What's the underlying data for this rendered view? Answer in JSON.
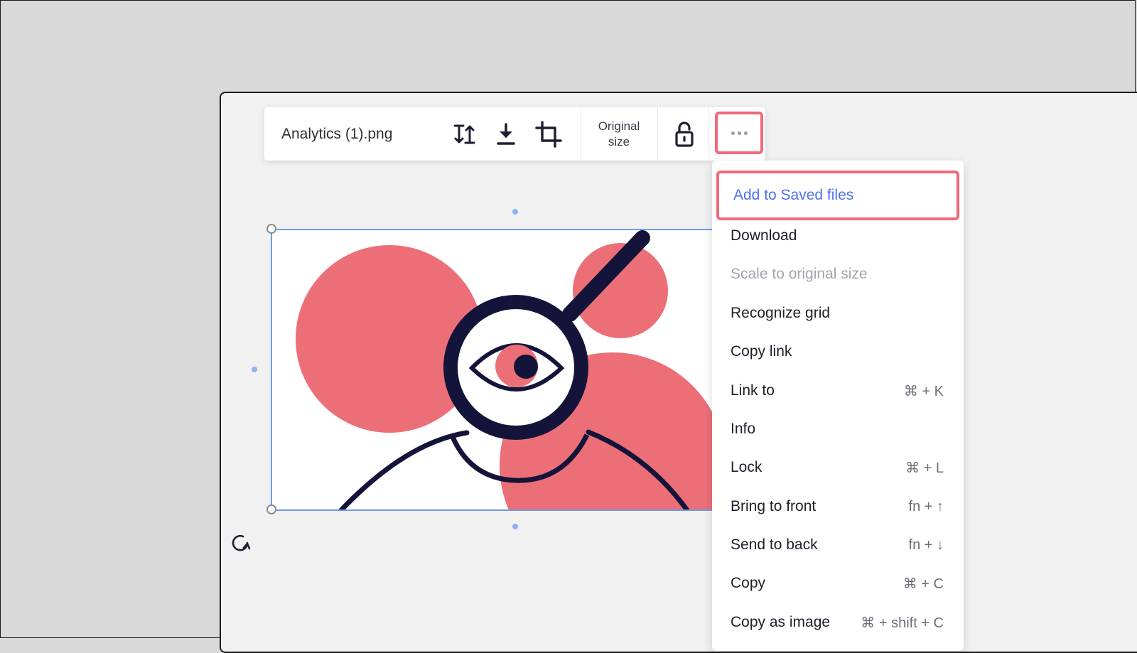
{
  "toolbar": {
    "file_name": "Analytics (1).png",
    "original_size_line1": "Original",
    "original_size_line2": "size"
  },
  "menu": {
    "items": [
      {
        "label": "Add to Saved files",
        "shortcut": ""
      },
      {
        "label": "Download",
        "shortcut": ""
      },
      {
        "label": "Scale to original size",
        "shortcut": ""
      },
      {
        "label": "Recognize grid",
        "shortcut": ""
      },
      {
        "label": "Copy link",
        "shortcut": ""
      },
      {
        "label": "Link to",
        "shortcut": "⌘ + K"
      },
      {
        "label": "Info",
        "shortcut": ""
      },
      {
        "label": "Lock",
        "shortcut": "⌘ + L"
      },
      {
        "label": "Bring to front",
        "shortcut": "fn + ↑"
      },
      {
        "label": "Send to back",
        "shortcut": "fn + ↓"
      },
      {
        "label": "Copy",
        "shortcut": "⌘ + C"
      },
      {
        "label": "Copy as image",
        "shortcut": "⌘ + shift + C"
      }
    ]
  },
  "colors": {
    "highlight_border": "#f06a7a",
    "highlight_text": "#4e6ff0",
    "illustration_pink": "#ec6f78",
    "illustration_ink": "#14143a",
    "selection": "#6f99e8"
  }
}
